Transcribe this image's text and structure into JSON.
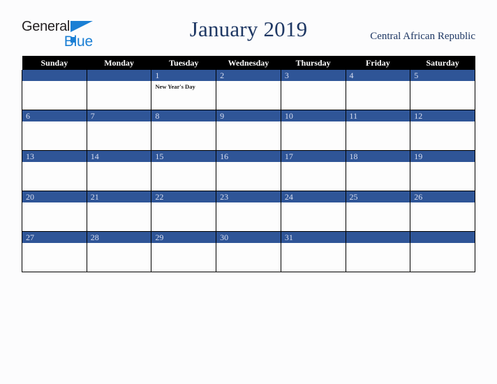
{
  "brand": {
    "name_top": "General",
    "name_bottom": "Blue",
    "accent_color": "#1b7fd4",
    "text_color": "#231f20"
  },
  "header": {
    "title": "January 2019",
    "country": "Central African Republic",
    "title_color": "#1f3864"
  },
  "calendar": {
    "header_bg": "#000000",
    "daynum_bg": "#2f5597",
    "daynum_color": "#d9def0",
    "weekday_headers": [
      "Sunday",
      "Monday",
      "Tuesday",
      "Wednesday",
      "Thursday",
      "Friday",
      "Saturday"
    ],
    "weeks": [
      [
        {
          "day": "",
          "events": []
        },
        {
          "day": "",
          "events": []
        },
        {
          "day": "1",
          "events": [
            "New Year's Day"
          ]
        },
        {
          "day": "2",
          "events": []
        },
        {
          "day": "3",
          "events": []
        },
        {
          "day": "4",
          "events": []
        },
        {
          "day": "5",
          "events": []
        }
      ],
      [
        {
          "day": "6",
          "events": []
        },
        {
          "day": "7",
          "events": []
        },
        {
          "day": "8",
          "events": []
        },
        {
          "day": "9",
          "events": []
        },
        {
          "day": "10",
          "events": []
        },
        {
          "day": "11",
          "events": []
        },
        {
          "day": "12",
          "events": []
        }
      ],
      [
        {
          "day": "13",
          "events": []
        },
        {
          "day": "14",
          "events": []
        },
        {
          "day": "15",
          "events": []
        },
        {
          "day": "16",
          "events": []
        },
        {
          "day": "17",
          "events": []
        },
        {
          "day": "18",
          "events": []
        },
        {
          "day": "19",
          "events": []
        }
      ],
      [
        {
          "day": "20",
          "events": []
        },
        {
          "day": "21",
          "events": []
        },
        {
          "day": "22",
          "events": []
        },
        {
          "day": "23",
          "events": []
        },
        {
          "day": "24",
          "events": []
        },
        {
          "day": "25",
          "events": []
        },
        {
          "day": "26",
          "events": []
        }
      ],
      [
        {
          "day": "27",
          "events": []
        },
        {
          "day": "28",
          "events": []
        },
        {
          "day": "29",
          "events": []
        },
        {
          "day": "30",
          "events": []
        },
        {
          "day": "31",
          "events": []
        },
        {
          "day": "",
          "events": []
        },
        {
          "day": "",
          "events": []
        }
      ]
    ]
  }
}
